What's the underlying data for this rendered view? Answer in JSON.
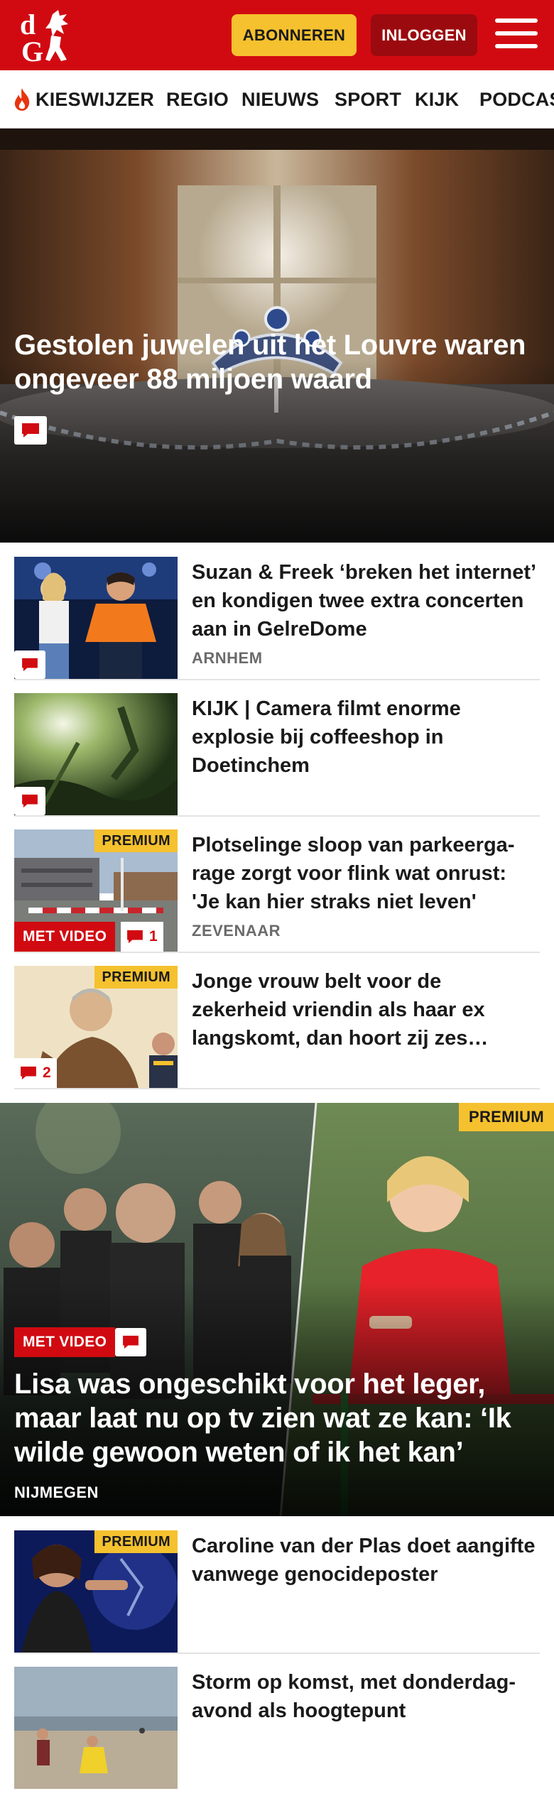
{
  "header": {
    "subscribe_label": "ABONNEREN",
    "login_label": "INLOGGEN",
    "logo_text": "dG",
    "brand_color": "#d10a11",
    "subscribe_color": "#f5c12e"
  },
  "nav": {
    "items": [
      {
        "label": "KIESWIJZER",
        "icon": "flame-icon"
      },
      {
        "label": "REGIO"
      },
      {
        "label": "NIEUWS"
      },
      {
        "label": "SPORT"
      },
      {
        "label": "KIJK"
      },
      {
        "label": "PODCAST"
      }
    ]
  },
  "hero": {
    "title": "Gestolen juwelen uit het Louvre waren ongeveer 88 miljoen waard",
    "icon": "comment-icon"
  },
  "articles": [
    {
      "title": "Suzan & Freek ‘breken het internet’ en kondigen twee extra concerten aan in GelreDome",
      "location": "ARNHEM",
      "comment_icon": "comment-icon"
    },
    {
      "title": "KIJK | Camera filmt enorme explosie bij coffeeshop in Doetinchem",
      "comment_icon": "comment-icon"
    },
    {
      "title": "Plotselinge sloop van parkeerga­rage zorgt voor flink wat onrust: 'Je kan hier straks niet leven'",
      "location": "ZEVENAAR",
      "premium_label": "PREMIUM",
      "video_label": "MET VIDEO",
      "comment_count": "1"
    },
    {
      "title": "Jonge vrouw belt voor de zekerheid vriendin als haar ex langskomt, dan hoort zij zes…",
      "premium_label": "PREMIUM",
      "comment_count": "2"
    }
  ],
  "feature": {
    "premium_label": "PREMIUM",
    "video_label": "MET VIDEO",
    "title": "Lisa was ongeschikt voor het leger, maar laat nu op tv zien wat ze kan: ‘Ik wilde gewoon weten of ik het kan’",
    "location": "NIJMEGEN"
  },
  "more_articles": [
    {
      "title": "Caroline van der Plas doet aangifte vanwege genocidepos­ter",
      "premium_label": "PREMIUM"
    },
    {
      "title": "Storm op komst, met donderdag­avond als hoogtepunt"
    }
  ]
}
